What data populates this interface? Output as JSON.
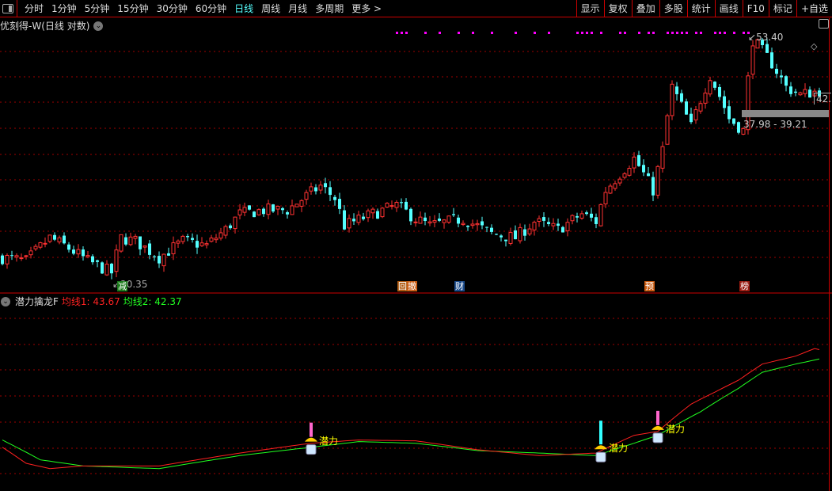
{
  "toolbar": {
    "periods": [
      "分时",
      "1分钟",
      "5分钟",
      "15分钟",
      "30分钟",
      "60分钟",
      "日线",
      "周线",
      "月线",
      "多周期",
      "更多 >"
    ],
    "active_period": "日线",
    "right_buttons": [
      "显示",
      "复权",
      "叠加",
      "多股",
      "统计",
      "画线",
      "F10",
      "标记",
      "+自选"
    ]
  },
  "title": "优刻得-W(日线 对数)",
  "price_panel": {
    "high_label": "53.40",
    "low_label": "20.35",
    "current_label": "42.",
    "range_label": "37.98 - 39.21",
    "tags": [
      {
        "text": "减",
        "bar": 25,
        "color": "#1a7a1a"
      },
      {
        "text": "回",
        "bar": 84,
        "color": "#b05a10"
      },
      {
        "text": "撤",
        "bar": 86,
        "color": "#c85a10"
      },
      {
        "text": "财",
        "bar": 96,
        "color": "#1a4a8a"
      },
      {
        "text": "预",
        "bar": 136,
        "color": "#c85a10"
      },
      {
        "text": "榜",
        "bar": 156,
        "color": "#9a1a10"
      }
    ],
    "anchors": [
      [
        0,
        22.5
      ],
      [
        5,
        22.2
      ],
      [
        10,
        24.3
      ],
      [
        13,
        23.6
      ],
      [
        18,
        22.2
      ],
      [
        23,
        21.2
      ],
      [
        25,
        24.3
      ],
      [
        28,
        24.0
      ],
      [
        33,
        22.5
      ],
      [
        38,
        24.0
      ],
      [
        43,
        23.6
      ],
      [
        47,
        25.1
      ],
      [
        50,
        26.7
      ],
      [
        55,
        27.1
      ],
      [
        60,
        27.1
      ],
      [
        67,
        29.8
      ],
      [
        70,
        28.4
      ],
      [
        72,
        25.5
      ],
      [
        78,
        26.7
      ],
      [
        83,
        27.6
      ],
      [
        87,
        26.2
      ],
      [
        90,
        25.5
      ],
      [
        97,
        26.2
      ],
      [
        103,
        24.7
      ],
      [
        108,
        24.3
      ],
      [
        112,
        25.9
      ],
      [
        117,
        25.1
      ],
      [
        122,
        26.7
      ],
      [
        125,
        25.9
      ],
      [
        127,
        29.3
      ],
      [
        133,
        33.2
      ],
      [
        137,
        29.3
      ],
      [
        139,
        34.3
      ],
      [
        141,
        43.9
      ],
      [
        145,
        37.6
      ],
      [
        149,
        46.0
      ],
      [
        153,
        38.8
      ],
      [
        156,
        37.0
      ],
      [
        157,
        45.3
      ],
      [
        158,
        52.9
      ],
      [
        162,
        48.2
      ],
      [
        165,
        43.9
      ],
      [
        168,
        42.6
      ],
      [
        172,
        43.3
      ]
    ],
    "dot_bars": [
      83,
      84,
      85,
      89,
      92,
      96,
      99,
      103,
      108,
      112,
      115,
      121,
      122,
      123,
      124,
      126,
      130,
      131,
      134,
      136,
      137,
      140,
      141,
      142,
      143,
      144,
      146,
      147,
      150,
      151,
      152,
      154,
      156,
      157
    ]
  },
  "indicator": {
    "name": "潜力擒龙F",
    "ma1_label": "均线1:",
    "ma1_value": "43.67",
    "ma2_label": "均线2:",
    "ma2_value": "42.37",
    "ma1": [
      [
        0,
        29.1
      ],
      [
        5,
        27.2
      ],
      [
        10,
        26.6
      ],
      [
        17,
        26.9
      ],
      [
        33,
        26.9
      ],
      [
        50,
        28.4
      ],
      [
        65,
        29.6
      ],
      [
        75,
        30.0
      ],
      [
        87,
        29.9
      ],
      [
        100,
        28.8
      ],
      [
        113,
        28.1
      ],
      [
        125,
        28.4
      ],
      [
        133,
        30.6
      ],
      [
        138,
        31.1
      ],
      [
        145,
        34.9
      ],
      [
        150,
        36.7
      ],
      [
        155,
        38.6
      ],
      [
        160,
        41.3
      ],
      [
        167,
        42.7
      ],
      [
        171,
        44.1
      ],
      [
        173,
        43.67
      ]
    ],
    "ma2": [
      [
        0,
        30.0
      ],
      [
        8,
        27.6
      ],
      [
        17,
        26.9
      ],
      [
        33,
        26.6
      ],
      [
        50,
        28.1
      ],
      [
        65,
        29.1
      ],
      [
        75,
        29.8
      ],
      [
        87,
        29.6
      ],
      [
        100,
        28.7
      ],
      [
        113,
        28.4
      ],
      [
        125,
        28.1
      ],
      [
        133,
        29.6
      ],
      [
        138,
        30.6
      ],
      [
        147,
        33.8
      ],
      [
        155,
        37.3
      ],
      [
        160,
        39.9
      ],
      [
        167,
        41.3
      ],
      [
        173,
        42.37
      ]
    ],
    "signals": [
      {
        "bar": 65,
        "text": "潜力",
        "spike_color": "#ff66cc"
      },
      {
        "bar": 126,
        "text": "潜力",
        "spike_color": "#33ffff"
      },
      {
        "bar": 138,
        "text": "潜力",
        "spike_color": "#ff66cc"
      }
    ]
  },
  "colors": {
    "up": "#ff3232",
    "down": "#54ffff",
    "ma1": "#ff2020",
    "ma2": "#20ff20",
    "grid": "#a00000",
    "dots": "#ff00ff"
  }
}
